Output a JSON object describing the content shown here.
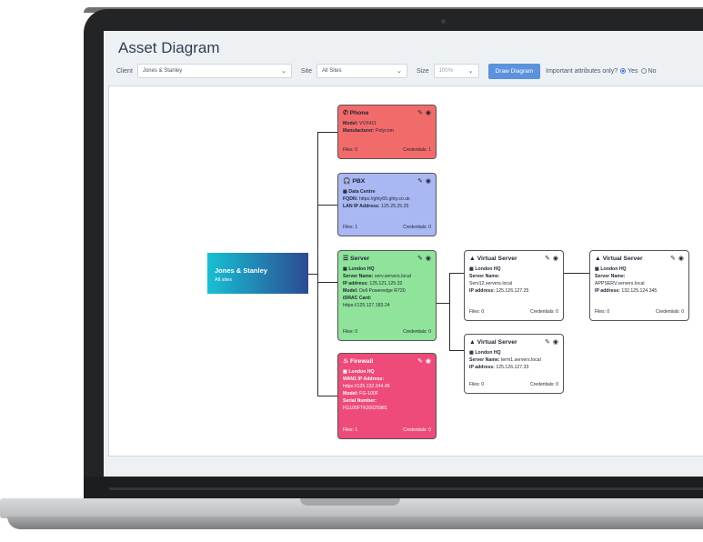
{
  "app": {
    "title": "Asset Diagram",
    "client_label": "Client",
    "client_value": "Jones & Stanley",
    "site_label": "Site",
    "site_value": "All Sites",
    "size_label": "Size",
    "size_value": "100%",
    "draw_button": "Draw Diagram",
    "important_label": "Important attributes only?",
    "yes_label": "Yes",
    "no_label": "No",
    "important_selected": "Yes"
  },
  "root": {
    "title": "Jones & Stanley",
    "subtitle": "All sites"
  },
  "cards": {
    "phone": {
      "title": "Phone",
      "rows": [
        {
          "label": "Model:",
          "value": "VVX411"
        },
        {
          "label": "Manufacturer:",
          "value": "Polycom"
        }
      ],
      "files": "Files: 0",
      "credentials": "Credentials: 1"
    },
    "pbx": {
      "title": "PBX",
      "site": "Data Centre",
      "rows": [
        {
          "label": "FQDN:",
          "value": "https://ghty65.ghty.co.uk"
        },
        {
          "label": "LAN IP Address:",
          "value": "125.25.25.25"
        }
      ],
      "files": "Files: 1",
      "credentials": "Credentials: 0"
    },
    "server": {
      "title": "Server",
      "site": "London HQ",
      "rows": [
        {
          "label": "Server Name:",
          "value": "serv.servers.local"
        },
        {
          "label": "IP address:",
          "value": "125.121.125.32"
        },
        {
          "label": "Model:",
          "value": "Dell Poweredge R720"
        },
        {
          "label": "iDRAC Card:",
          "value": ""
        },
        {
          "label": "",
          "value": "https://125.127.183.24"
        }
      ],
      "files": "Files: 0",
      "credentials": "Credentials: 0"
    },
    "firewall": {
      "title": "Firewall",
      "site": "London HQ",
      "rows": [
        {
          "label": "WAN1 IP Address:",
          "value": ""
        },
        {
          "label": "",
          "value": "https://125.132.244.45"
        },
        {
          "label": "Model:",
          "value": "FG-100F"
        },
        {
          "label": "Serial Number:",
          "value": ""
        },
        {
          "label": "",
          "value": "FG100FTK20025981"
        }
      ],
      "files": "Files: 1",
      "credentials": "Credentials: 0"
    },
    "vs1": {
      "title": "Virtual Server",
      "site": "London HQ",
      "rows": [
        {
          "label": "Server Name:",
          "value": ""
        },
        {
          "label": "",
          "value": "Serv12.servers.local"
        },
        {
          "label": "IP address:",
          "value": "125.126.127.25"
        }
      ],
      "files": "Files: 0",
      "credentials": "Credentials: 0"
    },
    "vs2": {
      "title": "Virtual Server",
      "site": "London HQ",
      "rows": [
        {
          "label": "Server Name:",
          "value": "term1.servers.local"
        },
        {
          "label": "IP address:",
          "value": "125.126.127.33"
        }
      ],
      "files": "Files: 0",
      "credentials": "Credentials: 0"
    },
    "vs3": {
      "title": "Virtual Server",
      "site": "London HQ",
      "rows": [
        {
          "label": "Server Name:",
          "value": ""
        },
        {
          "label": "",
          "value": "APPSERV.servers.local"
        },
        {
          "label": "IP address:",
          "value": "132.125.124.345"
        }
      ],
      "files": "Files: 0",
      "credentials": "Credentials: 0"
    }
  },
  "icons": {
    "phone": "phone-icon",
    "pbx": "headset-icon",
    "server": "server-icon",
    "firewall": "fire-icon",
    "vs": "virtual-server-icon",
    "site": "building-icon",
    "edit": "edit-icon",
    "view": "eye-icon"
  },
  "colors": {
    "phone": "#f26b6b",
    "pbx": "#a9b7f3",
    "server": "#8fe39a",
    "firewall": "#ee4b7a",
    "button": "#5b92dd"
  }
}
